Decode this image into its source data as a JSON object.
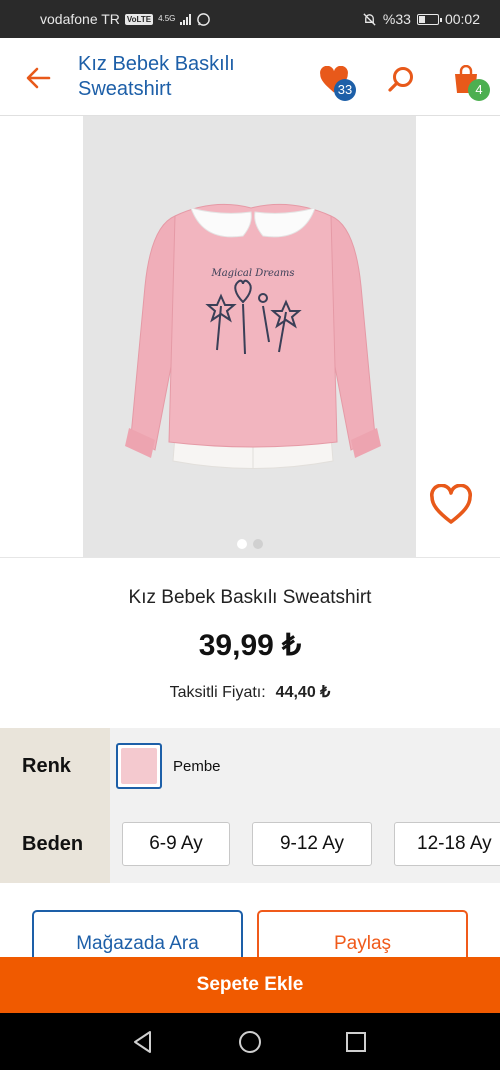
{
  "status_bar": {
    "carrier": "vodafone TR",
    "volte": "VoLTE",
    "network": "4.5G",
    "battery": "%33",
    "battery_level": 0.33,
    "time": "00:02"
  },
  "header": {
    "title": "Kız Bebek Baskılı Sweatshirt",
    "favorites_count": "33",
    "cart_count": "4"
  },
  "gallery": {
    "image_count": 2,
    "active_index": 0,
    "print_text": "Magical Dreams"
  },
  "product": {
    "name": "Kız Bebek Baskılı Sweatshirt",
    "price": "39,99 ₺",
    "installment_label": "Taksitli Fiyatı:",
    "installment_price": "44,40 ₺"
  },
  "options": {
    "color_label": "Renk",
    "color_name": "Pembe",
    "color_hex": "#f4c9cf",
    "size_label": "Beden",
    "sizes": [
      "6-9 Ay",
      "9-12 Ay",
      "12-18 Ay"
    ]
  },
  "actions": {
    "store_search": "Mağazada Ara",
    "share": "Paylaş",
    "add_to_cart": "Sepete Ekle"
  },
  "colors": {
    "brand_blue": "#1d5fa8",
    "brand_orange": "#f05a00",
    "icon_orange": "#e8591a",
    "badge_blue": "#1d5fa8",
    "badge_green": "#4caf50"
  }
}
